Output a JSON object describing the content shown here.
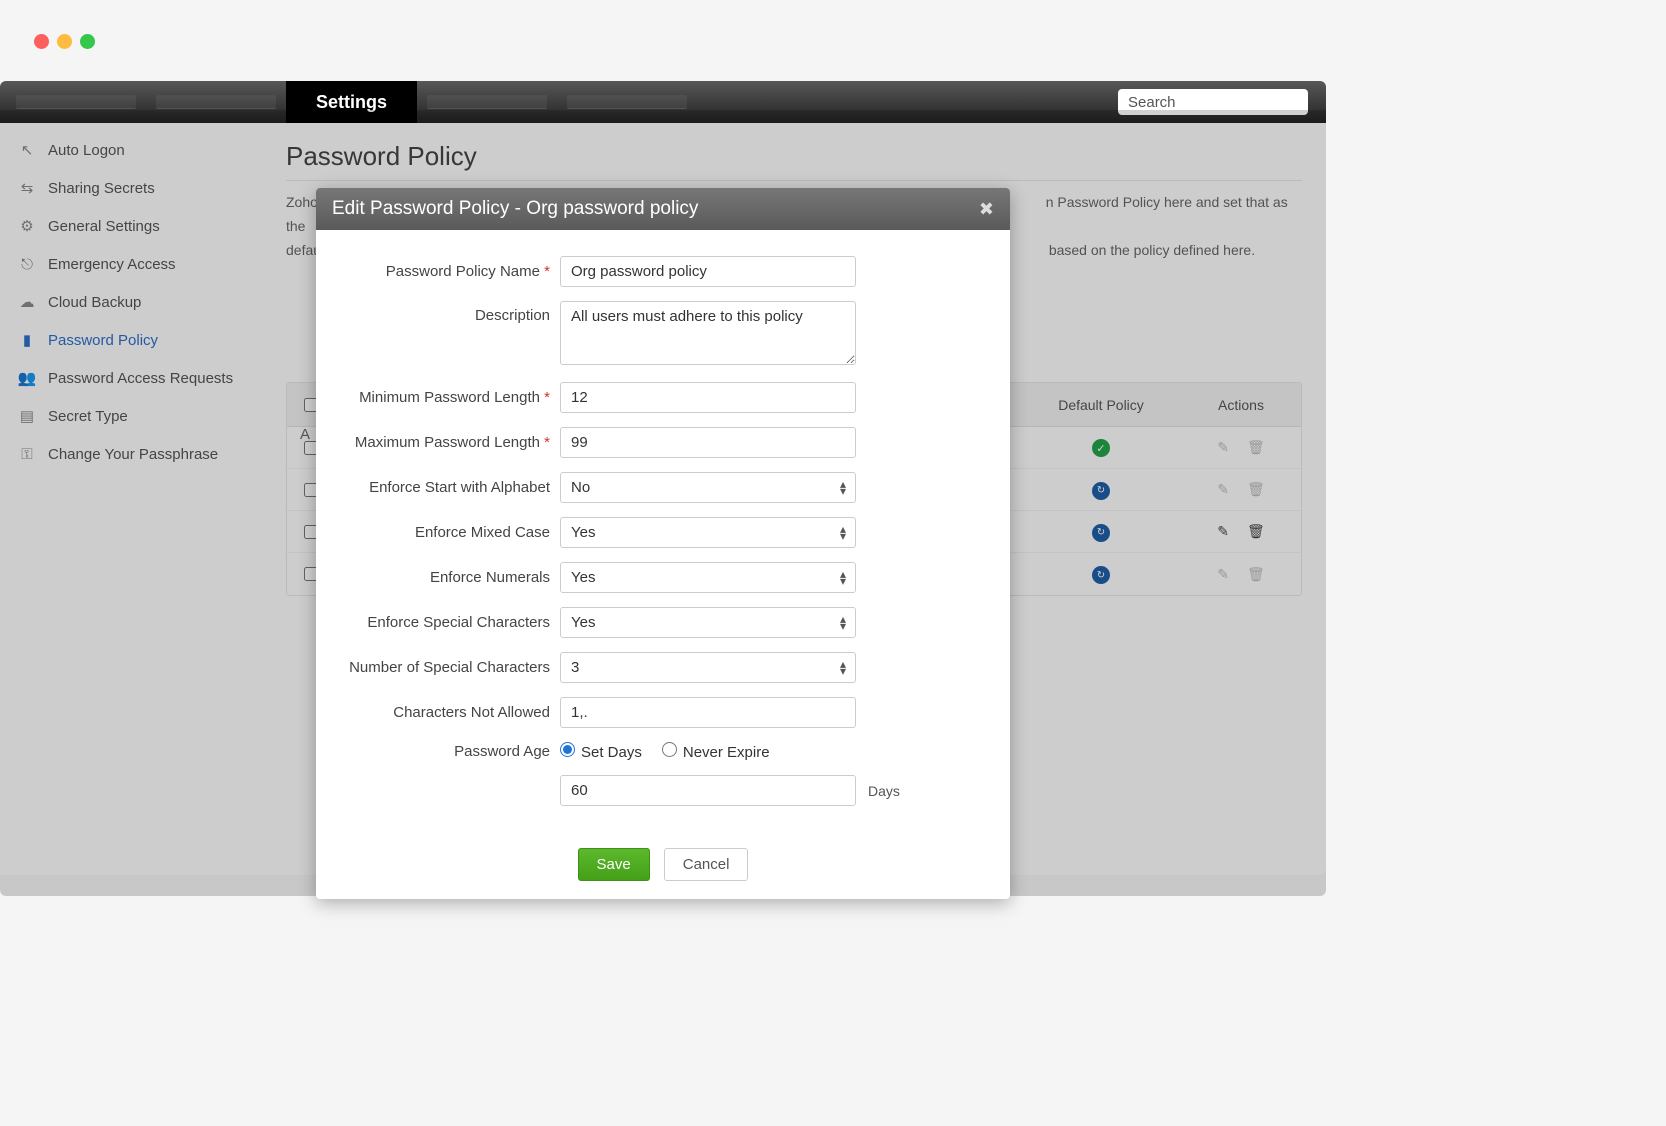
{
  "nav": {
    "active_tab": "Settings",
    "search_placeholder": "Search"
  },
  "sidebar": {
    "items": [
      {
        "label": "Auto Logon",
        "icon": "cursor-icon"
      },
      {
        "label": "Sharing Secrets",
        "icon": "share-icon"
      },
      {
        "label": "General Settings",
        "icon": "gear-icon"
      },
      {
        "label": "Emergency Access",
        "icon": "exit-icon"
      },
      {
        "label": "Cloud Backup",
        "icon": "cloud-icon"
      },
      {
        "label": "Password Policy",
        "icon": "shield-icon",
        "active": true
      },
      {
        "label": "Password Access Requests",
        "icon": "users-icon"
      },
      {
        "label": "Secret Type",
        "icon": "list-icon"
      },
      {
        "label": "Change Your Passphrase",
        "icon": "key-icon"
      }
    ]
  },
  "page": {
    "title": "Password Policy",
    "intro_prefix": "Zoho",
    "intro_suffix_1": "n Password Policy here and set that as the",
    "intro_line2_prefix": "defau",
    "intro_suffix_2": "based on the policy defined here."
  },
  "table": {
    "add_letter": "A",
    "headers": {
      "default": "Default Policy",
      "actions": "Actions"
    },
    "rows": [
      {
        "badge": "green"
      },
      {
        "badge": "blue"
      },
      {
        "badge": "blue",
        "actions_dark": true
      },
      {
        "badge": "blue"
      }
    ]
  },
  "modal": {
    "title": "Edit Password Policy - Org password policy",
    "fields": {
      "name_label": "Password Policy Name",
      "name_value": "Org password policy",
      "desc_label": "Description",
      "desc_value": "All users must adhere to this policy",
      "minlen_label": "Minimum Password Length",
      "minlen_value": "12",
      "maxlen_label": "Maximum Password Length",
      "maxlen_value": "99",
      "startalpha_label": "Enforce Start with Alphabet",
      "startalpha_value": "No",
      "mixed_label": "Enforce Mixed Case",
      "mixed_value": "Yes",
      "numerals_label": "Enforce Numerals",
      "numerals_value": "Yes",
      "special_label": "Enforce Special Characters",
      "special_value": "Yes",
      "numspecial_label": "Number of Special Characters",
      "numspecial_value": "3",
      "notallowed_label": "Characters Not Allowed",
      "notallowed_value": "1,.",
      "age_label": "Password Age",
      "age_radio1": "Set Days",
      "age_radio2": "Never Expire",
      "age_days_value": "60",
      "age_suffix": "Days"
    },
    "buttons": {
      "save": "Save",
      "cancel": "Cancel"
    }
  }
}
